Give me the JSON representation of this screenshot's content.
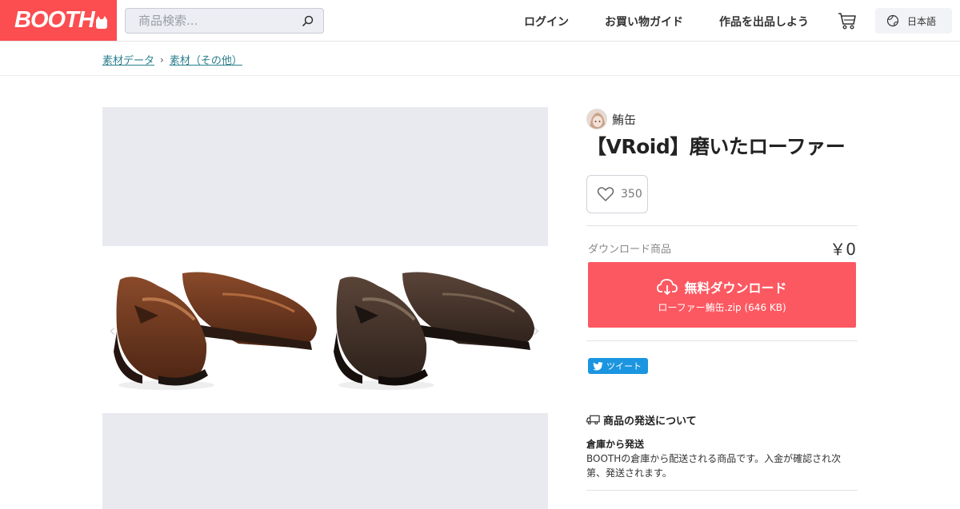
{
  "brand": {
    "name": "BOOTH",
    "color": "#fc4d50"
  },
  "search": {
    "placeholder": "商品検索..."
  },
  "nav": {
    "login": "ログイン",
    "guide": "お買い物ガイド",
    "sell": "作品を出品しよう",
    "language": "日本語"
  },
  "breadcrumb": [
    "素材データ",
    "素材（その他）"
  ],
  "product": {
    "shop_name": "鮪缶",
    "title": "【VRoid】磨いたローファー",
    "likes": "350",
    "type_label": "ダウンロード商品",
    "price": "￥0",
    "download_label": "無料ダウンロード",
    "download_file": "ローファー鮪缶.zip (646 KB)",
    "tweet_label": "ツイート"
  },
  "shipping": {
    "heading": "商品の発送について",
    "method": "倉庫から発送",
    "description": "BOOTHの倉庫から配送される商品です。入金が確認され次第、発送されます。"
  },
  "icons": {
    "search": "search-icon",
    "cart": "cart-icon",
    "globe": "globe-icon",
    "heart": "heart-icon",
    "download": "cloud-download-icon",
    "twitter": "twitter-bird-icon",
    "truck": "truck-icon"
  },
  "colors": {
    "accent": "#fc5861",
    "link": "#2b7f8c",
    "twitter": "#1b95e0"
  }
}
